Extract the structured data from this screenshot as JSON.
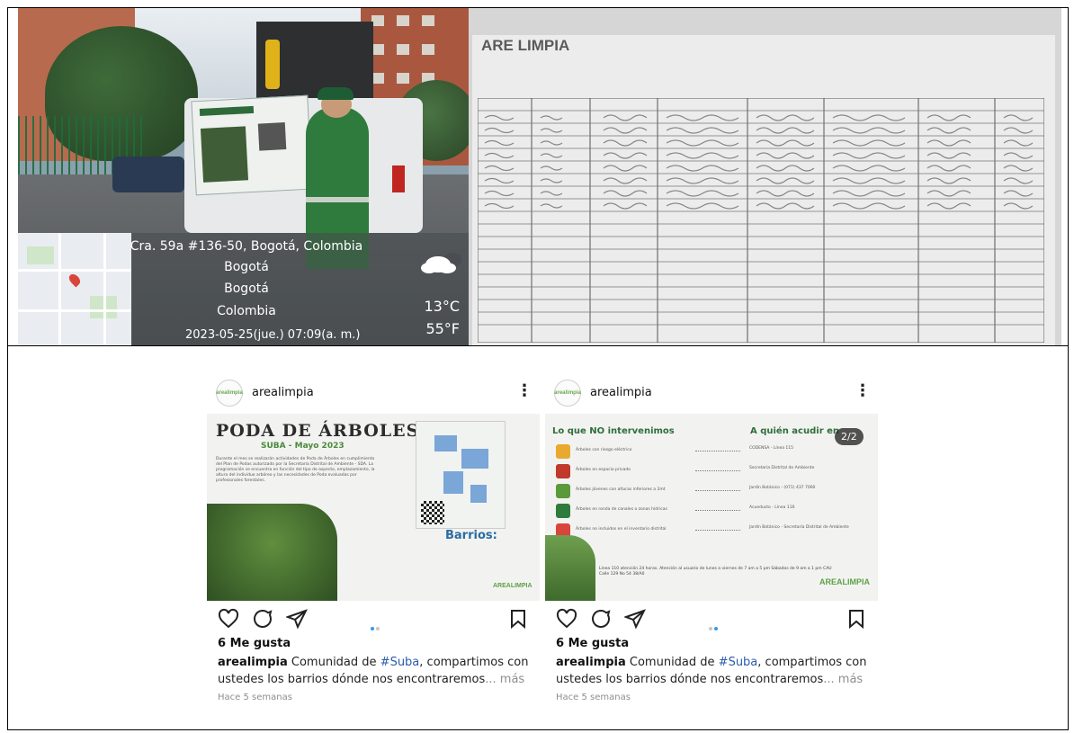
{
  "photo": {
    "address": "Cra. 59a #136-50, Bogotá, Colombia",
    "line2": "Bogotá",
    "line3": "Bogotá",
    "line4": "Colombia",
    "datetime": "2023-05-25(jue.)  07:09(a. m.)",
    "temp_c": "13°C",
    "temp_f": "55°F",
    "weather_icon": "cloud-icon"
  },
  "document": {
    "logo": "ARE LIMPIA"
  },
  "posts": [
    {
      "username": "arealimpia",
      "avatar_label": "arealimpia",
      "graphic": {
        "title": "PODA DE ÁRBOLES",
        "subtitle": "SUBA - Mayo 2023",
        "body": "Durante el mes se realizarán actividades de Poda de Árboles en cumplimiento del Plan de Podas autorizado por la Secretaría Distrital de Ambiente - SDA. La programación se encuentra en función del tipo de aspecto, emplazamiento, la altura del individuo arbóreo y las necesidades de Poda evaluadas por profesionales forestales.",
        "barrios_title": "Barrios:",
        "logo": "AREALIMPIA"
      },
      "likes": "6 Me gusta",
      "caption_user": "arealimpia",
      "caption_pre": " Comunidad de ",
      "caption_tag": "#Suba",
      "caption_post": ", compartimos con ustedes los barrios dónde nos encontraremos",
      "caption_more": "... más",
      "time": "Hace 5 semanas",
      "active_dot": 0
    },
    {
      "username": "arealimpia",
      "avatar_label": "arealimpia",
      "graphic": {
        "left_title": "Lo que NO intervenimos",
        "right_title": "A quién acudir en",
        "counter": "2/2",
        "rows": [
          {
            "item": "Árboles con riesgo eléctrico",
            "who": "CODENSA - Línea 115",
            "color": "#e8a92e"
          },
          {
            "item": "Árboles en espacio privado",
            "who": "Secretaría Distrital de Ambiente",
            "color": "#c0392b"
          },
          {
            "item": "Árboles jóvenes con alturas inferiores a 2mt",
            "who": "Jardín Botánico - (071) 437 7060",
            "color": "#5a9a3a"
          },
          {
            "item": "Árboles en ronda de canales o zonas hídricas",
            "who": "Acueducto - Línea 116",
            "color": "#2f7a3d"
          },
          {
            "item": "Árboles no incluidos en el inventario distrital",
            "who": "Jardín Botánico - Secretaría Distrital de Ambiente",
            "color": "#d9453b"
          }
        ],
        "footer": "Línea 110 atención 24 horas. Atención al usuario de lunes a viernes de 7 am a 5 pm Sábados de 9 am a 1 pm CAU Calle 129 No 54 38/A0",
        "logo": "AREALIMPIA"
      },
      "likes": "6 Me gusta",
      "caption_user": "arealimpia",
      "caption_pre": " Comunidad de ",
      "caption_tag": "#Suba",
      "caption_post": ", compartimos con ustedes los barrios dónde nos encontraremos",
      "caption_more": "... más",
      "time": "Hace 5 semanas",
      "active_dot": 1
    }
  ],
  "colors": {
    "accent_blue": "#3897f0",
    "tag_blue": "#2a5dab",
    "brand_green": "#5ea144"
  }
}
